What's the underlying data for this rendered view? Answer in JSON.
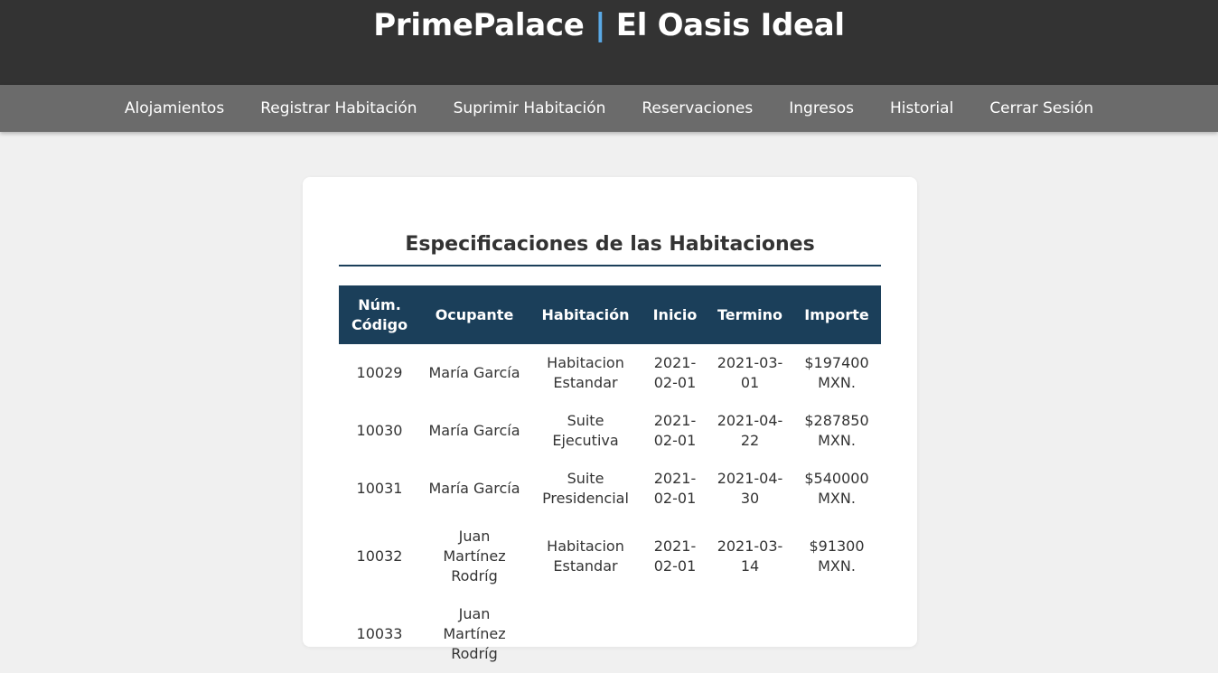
{
  "header": {
    "brand": "PrimePalace",
    "separator": "|",
    "tagline": "El Oasis Ideal"
  },
  "nav": [
    {
      "label": "Alojamientos"
    },
    {
      "label": "Registrar Habitación"
    },
    {
      "label": "Suprimir Habitación"
    },
    {
      "label": "Reservaciones"
    },
    {
      "label": "Ingresos"
    },
    {
      "label": "Historial"
    },
    {
      "label": "Cerrar Sesión"
    }
  ],
  "card": {
    "title": "Especificaciones de las Habitaciones",
    "columns": [
      "Núm. Código",
      "Ocupante",
      "Habitación",
      "Inicio",
      "Termino",
      "Importe"
    ],
    "rows": [
      [
        "10029",
        "María García",
        "Habitacion Estandar",
        "2021-02-01",
        "2021-03-01",
        "$197400 MXN."
      ],
      [
        "10030",
        "María García",
        "Suite Ejecutiva",
        "2021-02-01",
        "2021-04-22",
        "$287850 MXN."
      ],
      [
        "10031",
        "María García",
        "Suite Presidencial",
        "2021-02-01",
        "2021-04-30",
        "$540000 MXN."
      ],
      [
        "10032",
        "Juan Martínez Rodríg",
        "Habitacion Estandar",
        "2021-02-01",
        "2021-03-14",
        "$91300 MXN."
      ],
      [
        "10033",
        "Juan Martínez Rodríg",
        "",
        "",
        "",
        ""
      ]
    ]
  }
}
